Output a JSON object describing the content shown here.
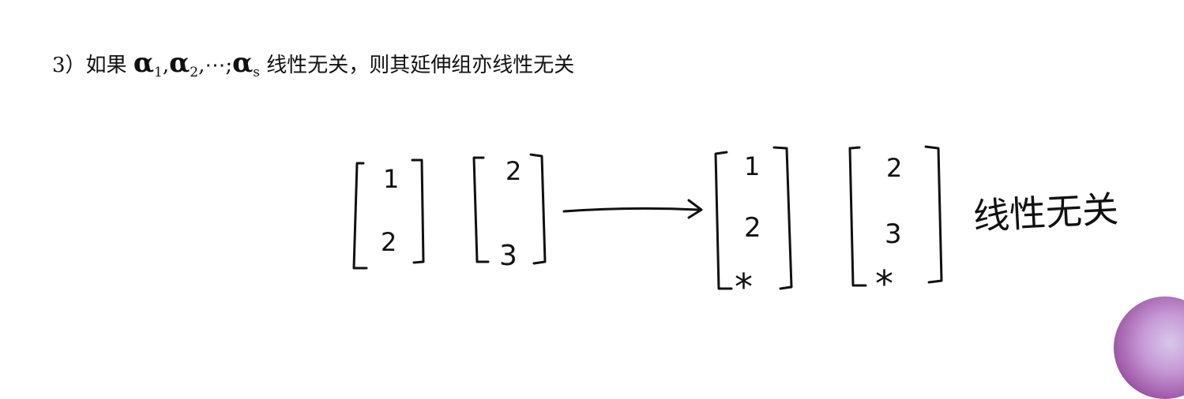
{
  "statement": {
    "number": "3）",
    "pre": "如果",
    "alpha": "α",
    "sub1": "1",
    "sub2": "2",
    "dots": "⋯",
    "subs": "s",
    "post": "线性无关，则其延伸组亦线性无关"
  },
  "handwriting": {
    "v1_top": "1",
    "v1_bottom": "2",
    "v2_top": "2",
    "v2_bottom": "3",
    "w1_top": "1",
    "w1_mid": "2",
    "w1_bottom": "*",
    "w2_top": "2",
    "w2_mid": "3",
    "w2_bottom": "*",
    "note": "线性无关"
  }
}
